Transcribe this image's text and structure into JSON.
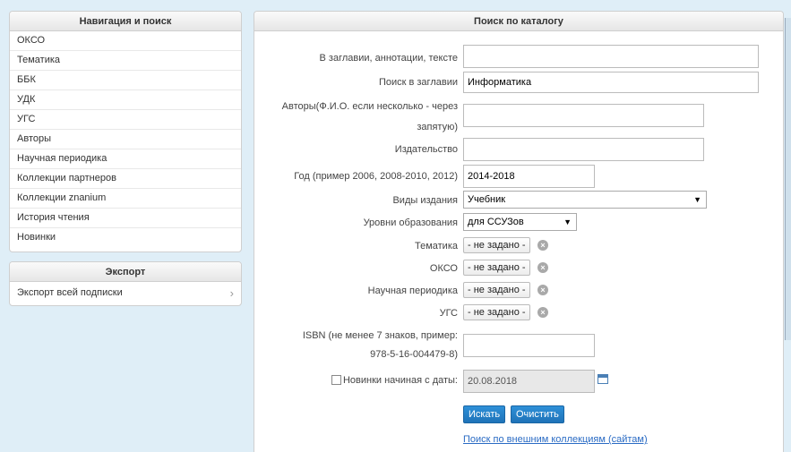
{
  "nav": {
    "title": "Навигация и поиск",
    "items": [
      "ОКСО",
      "Тематика",
      "ББК",
      "УДК",
      "УГС",
      "Авторы",
      "Научная периодика",
      "Коллекции партнеров",
      "Коллекции znanium",
      "История чтения",
      "Новинки"
    ]
  },
  "export": {
    "title": "Экспорт",
    "item": "Экспорт всей подписки"
  },
  "search": {
    "title": "Поиск по каталогу",
    "fields": {
      "annotation_label": "В заглавии, аннотации, тексте",
      "annotation_value": "",
      "title_label": "Поиск в заглавии",
      "title_value": "Информатика",
      "authors_label_1": "Авторы(Ф.И.О. если несколько - через",
      "authors_label_2": "запятую)",
      "authors_value": "",
      "publisher_label": "Издательство",
      "publisher_value": "",
      "year_label": "Год (пример 2006, 2008-2010, 2012)",
      "year_value": "2014-2018",
      "type_label": "Виды издания",
      "type_value": "Учебник",
      "level_label": "Уровни образования",
      "level_value": "для ССУЗов",
      "theme_label": "Тематика",
      "okso_label": "ОКСО",
      "periodic_label": "Научная периодика",
      "ugs_label": "УГС",
      "not_set": "- не задано -",
      "isbn_label_1": "ISBN (не менее 7 знаков, пример:",
      "isbn_label_2": "978-5-16-004479-8)",
      "isbn_value": "",
      "new_label": "Новинки начиная с даты:",
      "new_date": "20.08.2018"
    },
    "search_button": "Искать",
    "clear_button": "Очистить",
    "external_link": "Поиск по внешним коллекциям (сайтам)"
  },
  "colors": {
    "background": "#dfeef7",
    "button": "#1f73b8",
    "link": "#2a6bc4"
  }
}
